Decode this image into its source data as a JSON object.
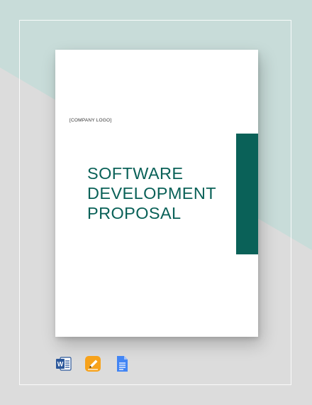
{
  "document": {
    "company_logo": "[COMPANY LOGO]",
    "title_lines": [
      "SOFTWARE",
      "DEVELOPMENT",
      "PROPOSAL"
    ]
  },
  "apps": [
    {
      "name": "word-icon",
      "letter": "W"
    },
    {
      "name": "pages-icon"
    },
    {
      "name": "google-docs-icon"
    }
  ],
  "colors": {
    "accent": "#0a6158",
    "bg_top": "#c8dcd9",
    "bg_bottom": "#dcdcdc",
    "word_blue": "#2b579a",
    "pages_orange": "#f7a21b",
    "docs_blue": "#4285f4"
  }
}
